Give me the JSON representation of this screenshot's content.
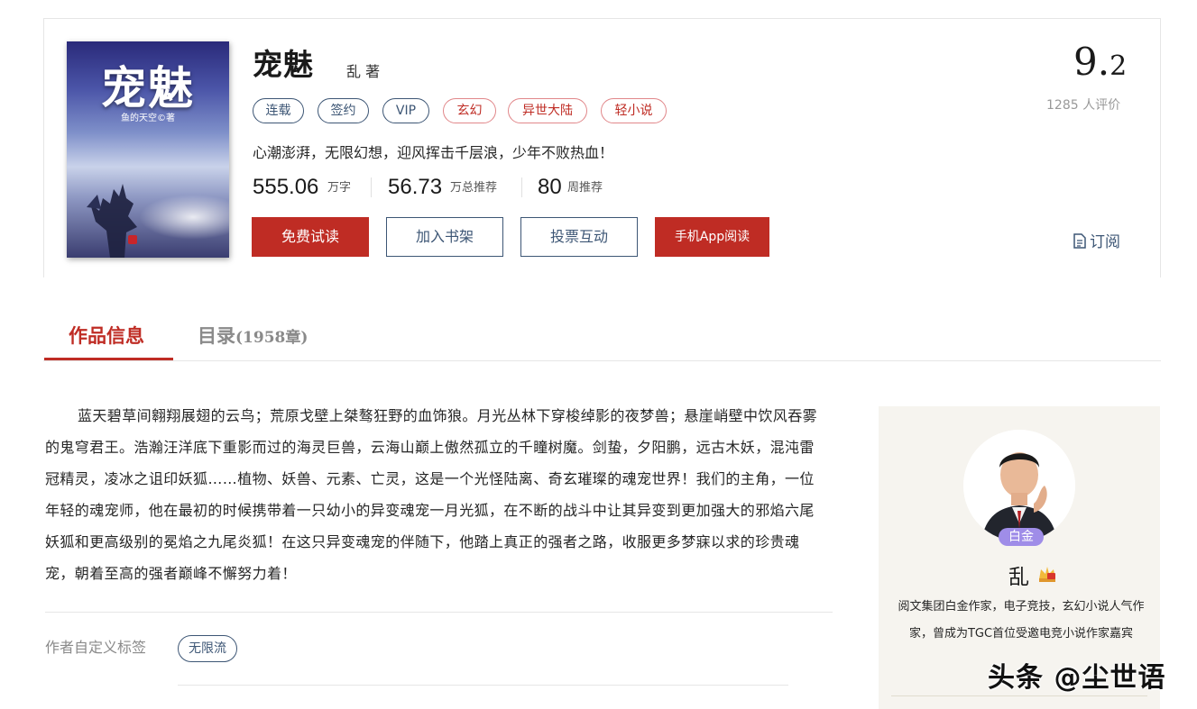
{
  "book": {
    "cover": {
      "title": "宠魅",
      "author_line": "鱼的天空©著"
    },
    "title": "宠魅",
    "author": "乱  著",
    "tags": [
      "连载",
      "签约",
      "VIP",
      "玄幻",
      "异世大陆",
      "轻小说"
    ],
    "intro": "心潮澎湃，无限幻想，迎风挥击千层浪，少年不败热血！",
    "stats": [
      {
        "value": "555.06",
        "unit": "万字"
      },
      {
        "value": "56.73",
        "unit": "万总推荐"
      },
      {
        "value": "80",
        "unit": "周推荐"
      }
    ],
    "buttons": {
      "read": "免费试读",
      "shelf": "加入书架",
      "vote": "投票互动",
      "app": "手机App阅读"
    },
    "rating": {
      "integer": "9.",
      "decimal": "2",
      "count": "1285",
      "count_label": "人评价"
    },
    "subscribe": "订阅"
  },
  "tabs": {
    "info": "作品信息",
    "toc": "目录",
    "toc_count": "(1958章)"
  },
  "description": "蓝天碧草间翱翔展翅的云鸟；荒原戈壁上桀骜狂野的血饰狼。月光丛林下穿梭绰影的夜梦兽；悬崖峭壁中饮风吞雾的鬼穹君王。浩瀚汪洋底下重影而过的海灵巨兽，云海山巅上傲然孤立的千瞳树魔。剑蛰，夕阳鹏，远古木妖，混沌雷冠精灵，凌冰之诅印妖狐……植物、妖兽、元素、亡灵，这是一个光怪陆离、奇玄璀璨的魂宠世界！我们的主角，一位年轻的魂宠师，他在最初的时候携带着一只幼小的异变魂宠一月光狐，在不断的战斗中让其异变到更加强大的邪焰六尾妖狐和更高级别的冕焰之九尾炎狐！在这只异变魂宠的伴随下，他踏上真正的强者之路，收服更多梦寐以求的珍贵魂宠，朝着至高的强者巅峰不懈努力着！",
  "custom_tags": {
    "label": "作者自定义标签",
    "tags": [
      "无限流"
    ]
  },
  "author_panel": {
    "level": "白金",
    "name": "乱",
    "bio": "阅文集团白金作家，电子竞技，玄幻小说人气作家，曾成为TGC首位受邀电竞小说作家嘉宾"
  },
  "watermark": "头条 @尘世语",
  "colors": {
    "brand_red": "#bf2c24",
    "tag_blue": "#3d5675",
    "panel_bg": "#f6f4ef",
    "level_purple": "#9f8de8"
  }
}
